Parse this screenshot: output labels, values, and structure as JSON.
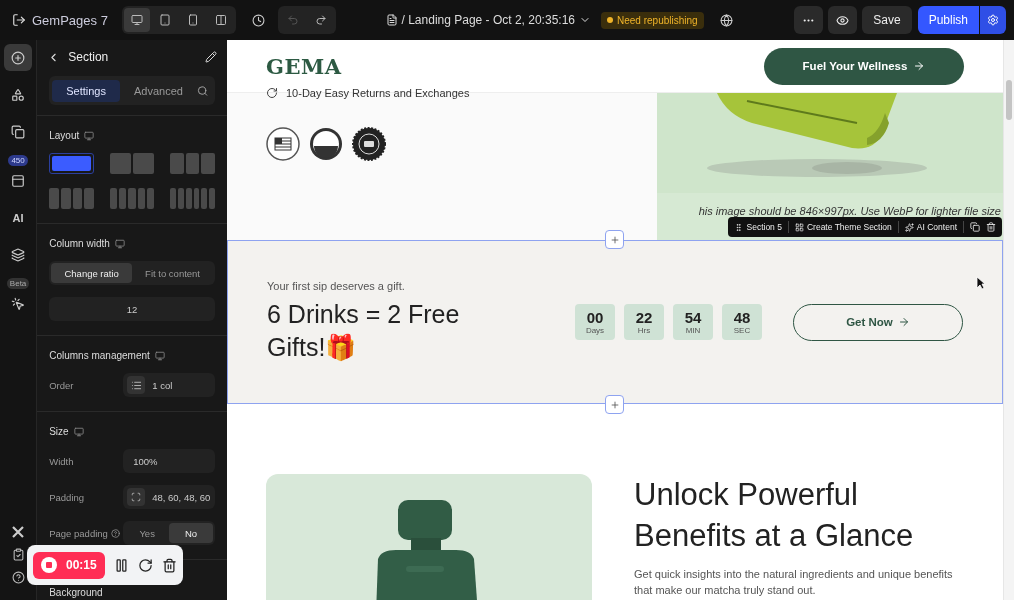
{
  "topbar": {
    "app_title": "GemPages 7",
    "devices": [
      {
        "kind": "desktop",
        "selected": true
      },
      {
        "kind": "tablet",
        "selected": false
      },
      {
        "kind": "mobile",
        "selected": false
      },
      {
        "kind": "split",
        "selected": false
      }
    ],
    "undo": {
      "disabled": true
    },
    "redo": {
      "disabled": false
    },
    "page_title": "/ Landing Page - Oct 2, 20:35:16",
    "status_badge": "Need republishing",
    "save": "Save",
    "publish": "Publish"
  },
  "rail": {
    "items": [
      {
        "kind": "add",
        "selected": true
      },
      {
        "kind": "elements",
        "selected": false
      },
      {
        "kind": "pages",
        "selected": false
      },
      {
        "kind": "templates",
        "selected": false,
        "badge": "450"
      },
      {
        "kind": "ai",
        "selected": false,
        "label": "AI"
      },
      {
        "kind": "layers",
        "selected": false
      },
      {
        "kind": "inspect",
        "selected": false,
        "badge": "Beta"
      }
    ],
    "bottom": [
      {
        "kind": "x"
      },
      {
        "kind": "clipboard"
      },
      {
        "kind": "help"
      }
    ]
  },
  "panel": {
    "title": "Section",
    "tabs": [
      {
        "label": "Settings",
        "selected": true
      },
      {
        "label": "Advanced",
        "selected": false
      }
    ],
    "layout": {
      "label": "Layout",
      "options": [
        {
          "kind": "c1",
          "selected": true
        },
        {
          "kind": "c2",
          "selected": false
        },
        {
          "kind": "c3",
          "selected": false
        },
        {
          "kind": "c4",
          "selected": false
        },
        {
          "kind": "c5",
          "selected": false
        },
        {
          "kind": "c6",
          "selected": false
        }
      ]
    },
    "column_width": {
      "label": "Column width",
      "options": [
        {
          "label": "Change ratio",
          "selected": true
        },
        {
          "label": "Fit to content",
          "selected": false
        }
      ],
      "value": "12"
    },
    "columns_management": {
      "label": "Columns management",
      "order_label": "Order",
      "order_value": "1 col"
    },
    "size": {
      "label": "Size",
      "width_label": "Width",
      "width_value": "100%",
      "padding_label": "Padding",
      "padding_value": "48, 60, 48, 60",
      "page_padding_label": "Page padding",
      "page_padding_options": [
        {
          "label": "Yes",
          "selected": false
        },
        {
          "label": "No",
          "selected": true
        }
      ]
    },
    "background_label": "Background"
  },
  "recorder": {
    "time": "00:15"
  },
  "canvas": {
    "header": {
      "logo": "GEMA",
      "cta": "Fuel Your Wellness"
    },
    "feature": "10-Day Easy Returns and Exchanges",
    "badges": [
      {
        "kind": "usa"
      },
      {
        "kind": "usda"
      },
      {
        "kind": "fda"
      }
    ],
    "image_note": "his image should be 846×997px. Use WebP for lighter file size",
    "section_toolbar": {
      "label": "Section 5",
      "create": "Create Theme Section",
      "ai": "AI Content"
    },
    "promo": {
      "eyebrow": "Your first sip deserves a gift.",
      "title": "6 Drinks = 2 Free Gifts!🎁",
      "countdown": [
        {
          "value": "00",
          "unit": "Days"
        },
        {
          "value": "22",
          "unit": "Hrs"
        },
        {
          "value": "54",
          "unit": "MIN"
        },
        {
          "value": "48",
          "unit": "SEC"
        }
      ],
      "button": "Get Now"
    },
    "benefits": {
      "title": "Unlock Powerful Benefits at a Glance",
      "text": "Get quick insights into the natural ingredients and unique benefits that make our matcha truly stand out."
    }
  }
}
